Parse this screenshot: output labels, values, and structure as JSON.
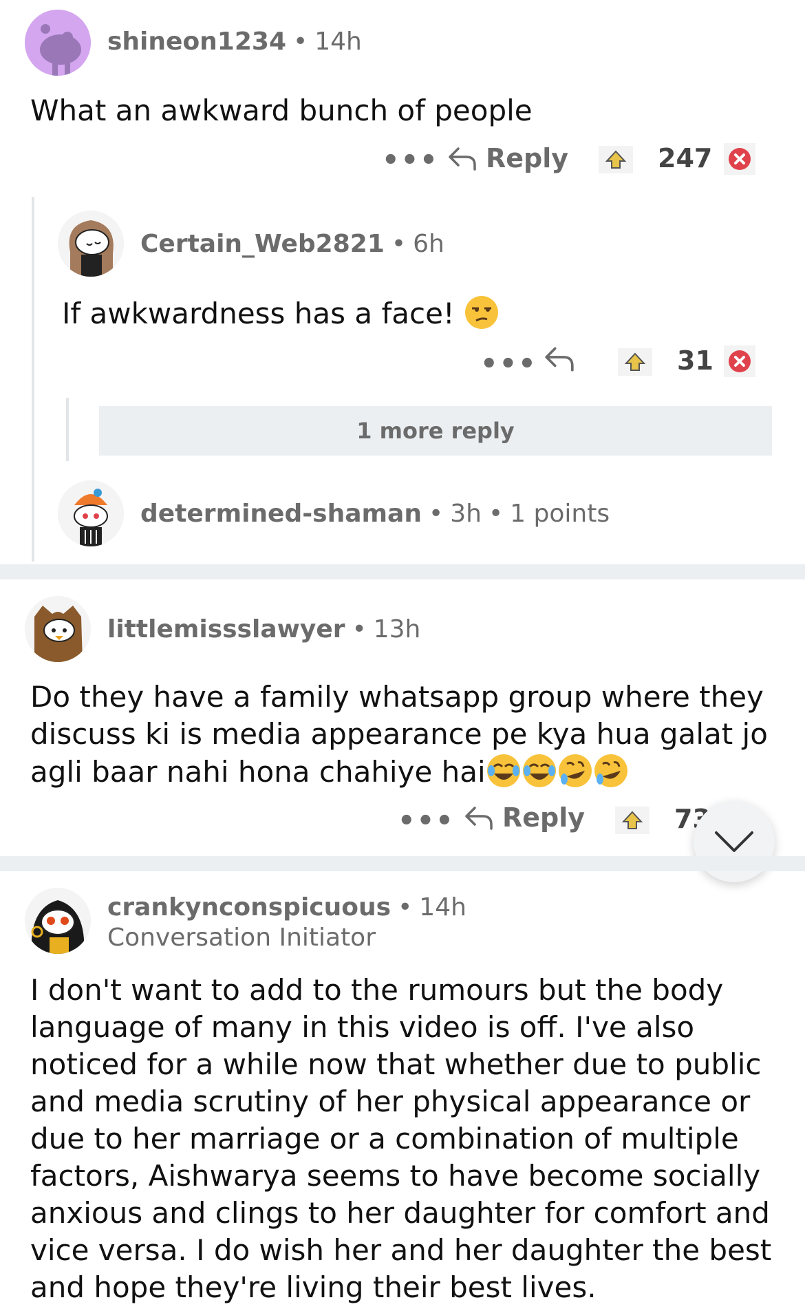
{
  "comments": [
    {
      "username": "shineon1234",
      "time": "14h",
      "text": "What an awkward bunch of people",
      "reply_label": "Reply",
      "votes": "247"
    },
    {
      "username": "Certain_Web2821",
      "time": "6h",
      "text": "If awkwardness has a face!",
      "votes": "31",
      "more_replies": "1 more reply"
    },
    {
      "username": "determined-shaman",
      "time": "3h",
      "points": "1 points"
    },
    {
      "username": "littlemissslawyer",
      "time": "13h",
      "text": "Do they have a family whatsapp group where they discuss ki is media appearance pe kya hua galat jo agli baar nahi hona chahiye hai",
      "reply_label": "Reply",
      "votes": "73"
    },
    {
      "username": "crankynconspicuous",
      "time": "14h",
      "flair": "Conversation Initiator",
      "text": "I don't want to add to the rumours but the body language of many in this video is off. I've also noticed for a while now that whether due to public and media scrutiny of her physical appearance or due to her marriage or a combination of multiple factors, Aishwarya seems to have become socially anxious and clings to her daughter for comfort and vice versa. I do wish her and her daughter the best and hope they're living their best lives."
    }
  ],
  "icons": [
    "avatar",
    "more-icon",
    "reply-icon",
    "upvote-icon",
    "downvote-icon",
    "scroll-down-icon",
    "emoji-unamused",
    "emoji-tears-of-joy",
    "emoji-rofl"
  ],
  "colors": {
    "downvote": "#e0424c",
    "upvote": "#e8c44a",
    "divider": "#eceff1",
    "meta": "#6b6b6b"
  }
}
